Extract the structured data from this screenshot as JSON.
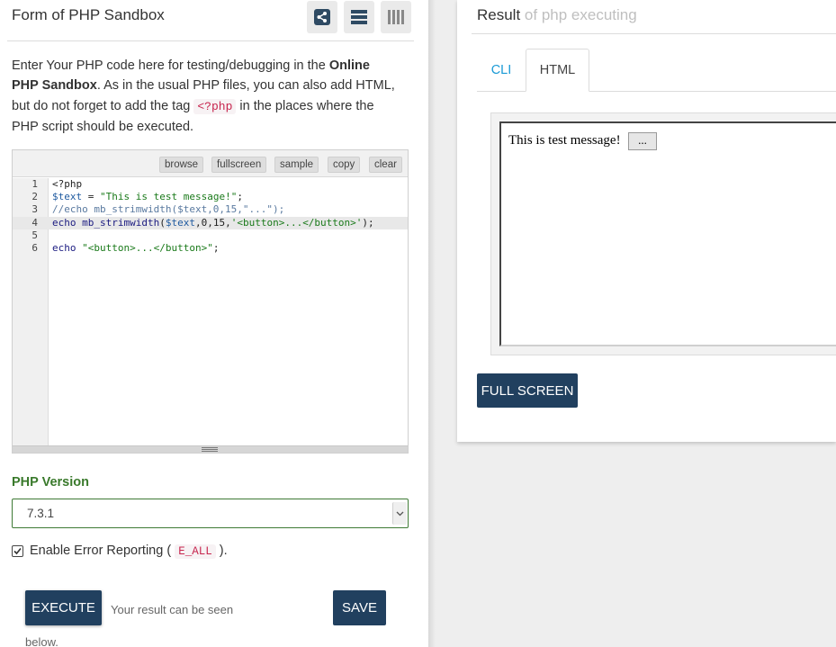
{
  "left": {
    "title": "Form of PHP Sandbox",
    "header_icons": [
      "share-icon",
      "list-icon",
      "columns-icon"
    ],
    "intro": {
      "part1": "Enter Your PHP code here for testing/debugging in the ",
      "bold1": "Online PHP Sandbox",
      "part2": ". As in the usual PHP files, you can also add HTML, but do not forget to add the tag ",
      "tag": "<?php",
      "part3": " in the places where the PHP script should be executed."
    },
    "toolbar": {
      "browse": "browse",
      "fullscreen": "fullscreen",
      "sample": "sample",
      "copy": "copy",
      "clear": "clear"
    },
    "code": {
      "active_line": 4,
      "lines": [
        {
          "num": "1",
          "text": "<?php"
        },
        {
          "num": "2",
          "text": "$text = \"This is test message!\";"
        },
        {
          "num": "3",
          "text": "//echo mb_strimwidth($text,0,15,\"...\");"
        },
        {
          "num": "4",
          "text": "echo mb_strimwidth($text,0,15,'<button>...</button>');"
        },
        {
          "num": "5",
          "text": ""
        },
        {
          "num": "6",
          "text": "echo \"<button>...</button>\";"
        }
      ]
    },
    "php_version": {
      "label": "PHP Version",
      "selected": "7.3.1"
    },
    "error_reporting": {
      "label": "Enable Error Reporting (",
      "code": "E_ALL",
      "suffix": ").",
      "checked": true
    },
    "execute_label": "EXECUTE",
    "save_label": "SAVE",
    "hint_line1": "Your result can be seen",
    "hint_line2": "below."
  },
  "right": {
    "title": "Result",
    "subtitle": "of php executing",
    "tabs": [
      {
        "label": "CLI",
        "active": false
      },
      {
        "label": "HTML",
        "active": true
      }
    ],
    "output_text": "This is test message!",
    "output_button": "...",
    "fullscreen_label": "FULL SCREEN"
  },
  "colors": {
    "dark_button": "#21405f",
    "accent_green": "#3a7a2c",
    "tab_link": "#1a9ad6",
    "code_tag": "#c7254e"
  }
}
